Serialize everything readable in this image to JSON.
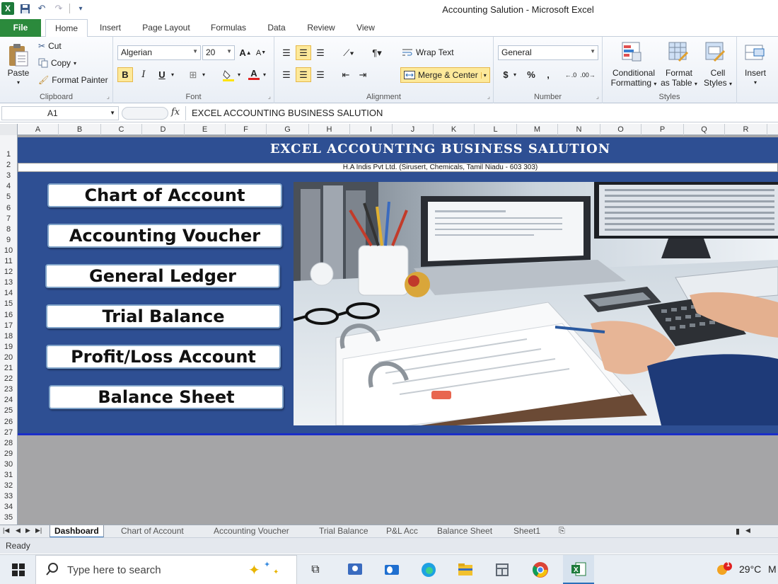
{
  "window": {
    "title": "Accounting Salution  -  Microsoft Excel"
  },
  "qat": {
    "app_icon": "X"
  },
  "ribbon_tabs": [
    "File",
    "Home",
    "Insert",
    "Page Layout",
    "Formulas",
    "Data",
    "Review",
    "View"
  ],
  "ribbon": {
    "clipboard": {
      "paste": "Paste",
      "cut": "Cut",
      "copy": "Copy",
      "format_painter": "Format Painter",
      "label": "Clipboard"
    },
    "font": {
      "name": "Algerian",
      "size": "20",
      "bold": "B",
      "italic": "I",
      "underline": "U",
      "label": "Font"
    },
    "alignment": {
      "wrap_text": "Wrap Text",
      "merge_center": "Merge & Center",
      "label": "Alignment"
    },
    "number": {
      "format": "General",
      "currency": "$",
      "percent": "%",
      "comma": ",",
      "label": "Number"
    },
    "styles": {
      "conditional_1": "Conditional",
      "conditional_2": "Formatting",
      "format_table_1": "Format",
      "format_table_2": "as Table",
      "cell_styles_1": "Cell",
      "cell_styles_2": "Styles",
      "label": "Styles"
    },
    "cells": {
      "insert": "Insert"
    }
  },
  "formula_bar": {
    "name_box": "A1",
    "fx": "fx",
    "content": "EXCEL ACCOUNTING BUSINESS SALUTION"
  },
  "columns": [
    "A",
    "B",
    "C",
    "D",
    "E",
    "F",
    "G",
    "H",
    "I",
    "J",
    "K",
    "L",
    "M",
    "N",
    "O",
    "P",
    "Q",
    "R"
  ],
  "rows": [
    "1",
    "2",
    "3",
    "4",
    "5",
    "6",
    "7",
    "8",
    "9",
    "10",
    "11",
    "12",
    "13",
    "14",
    "15",
    "16",
    "17",
    "18",
    "19",
    "20",
    "21",
    "22",
    "23",
    "24",
    "25",
    "26",
    "27",
    "28",
    "29",
    "30",
    "31",
    "32",
    "33",
    "34",
    "35"
  ],
  "sheet": {
    "title": "EXCEL ACCOUNTING BUSINESS SALUTION",
    "subtitle": "H.A Indis Pvt Ltd. (Sirusert, Chemicals, Tamil Niadu - 603 303)",
    "buttons": [
      "Chart of Account",
      "Accounting Voucher",
      "General Ledger",
      "Trial Balance",
      "Profit/Loss Account",
      "Balance Sheet"
    ],
    "colors": {
      "banner": "#2e4f93",
      "accent": "#1a2ec8"
    }
  },
  "sheet_tabs": [
    "Dashboard",
    "Chart of Account",
    "Accounting Voucher",
    "Trial Balance",
    "P&L Acc",
    "Balance Sheet",
    "Sheet1"
  ],
  "status": {
    "text": "Ready"
  },
  "taskbar": {
    "search_placeholder": "Type here to search",
    "temperature": "29°C",
    "weather_extra": "M",
    "notification_count": "1"
  }
}
